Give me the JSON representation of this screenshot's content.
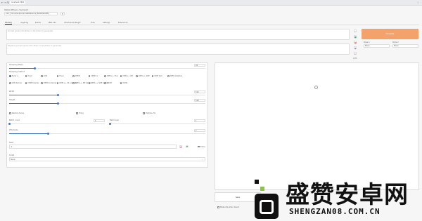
{
  "browser": {
    "url": "localhost:7861",
    "back_icon": "back-arrow-icon",
    "forward_icon": "forward-arrow-icon",
    "reload_icon": "reload-icon",
    "menu_icon": "kebab-menu-icon"
  },
  "header": {
    "checkpoint_label": "Stable Diffusion checkpoint",
    "checkpoint_value": "v2-1_512-ema-pruned.safetensors [8a4e5a5d26]",
    "refresh_icon": "refresh-icon"
  },
  "tabs": [
    {
      "label": "txt2img",
      "active": true
    },
    {
      "label": "img2img",
      "active": false
    },
    {
      "label": "Extras",
      "active": false
    },
    {
      "label": "PNG Info",
      "active": false
    },
    {
      "label": "Checkpoint Merger",
      "active": false
    },
    {
      "label": "Train",
      "active": false
    },
    {
      "label": "Settings",
      "active": false
    },
    {
      "label": "Extensions",
      "active": false
    }
  ],
  "prompt": {
    "placeholder": "Prompt (press Ctrl+Enter or Alt+Enter to generate)",
    "negative_placeholder": "Negative prompt (press Ctrl+Enter or Alt+Enter to generate)"
  },
  "tools": {
    "icons": [
      "arrow-icon",
      "trash-icon",
      "clipboard-icon",
      "art-icon",
      "save-style-icon"
    ],
    "count": "0/75"
  },
  "generate": {
    "label": "Generate",
    "color": "#f4a26b"
  },
  "styles": {
    "style1_label": "Style 1",
    "style1_value": "None",
    "style2_label": "Style 2",
    "style2_value": "None"
  },
  "settings": {
    "sampling_steps_label": "Sampling Steps",
    "sampling_steps_value": "20",
    "sampling_steps_fraction": 0.13,
    "sampling_method_label": "Sampling method",
    "sampling_methods": [
      "Euler a",
      "Euler",
      "LMS",
      "Heun",
      "DPM2",
      "DPM2 a",
      "DPM++ 2S a",
      "DPM++ 2M",
      "DPM++ SDE",
      "DPM fast",
      "DPM adaptive",
      "LMS Karras",
      "DPM2 Karras",
      "DPM2 a Karras",
      "DPM++ 2S a Karras",
      "DPM++ 2M Karras",
      "DPM++ SDE Karras",
      "DDIM",
      "PLMS"
    ],
    "selected_method_index": 0,
    "width_label": "Width",
    "width_value": "512",
    "width_fraction": 0.25,
    "height_label": "Height",
    "height_value": "512",
    "height_fraction": 0.25,
    "restore_faces_label": "Restore faces",
    "tiling_label": "Tiling",
    "hires_fix_label": "Highres. fix",
    "batch_count_label": "Batch count",
    "batch_count_value": "1",
    "batch_count_fraction": 0.0,
    "batch_size_label": "Batch size",
    "batch_size_value": "1",
    "batch_size_fraction": 0.0,
    "cfg_label": "CFG Scale",
    "cfg_value": "7",
    "cfg_fraction": 0.2,
    "seed_label": "Seed",
    "seed_value": "-1",
    "dice_icon": "dice-icon",
    "recycle_icon": "recycle-icon",
    "extra_label": "Extra",
    "script_label": "Script",
    "script_value": "None",
    "script_chevron": "chevron-down-icon"
  },
  "output": {
    "image_icon": "image-icon",
    "save_label": "Save",
    "make_zip_label": "Make Zip when Save?"
  },
  "watermark": {
    "cn_text": "盛赞安卓网",
    "url_text": "SHENGZAN08.COM.CN"
  }
}
